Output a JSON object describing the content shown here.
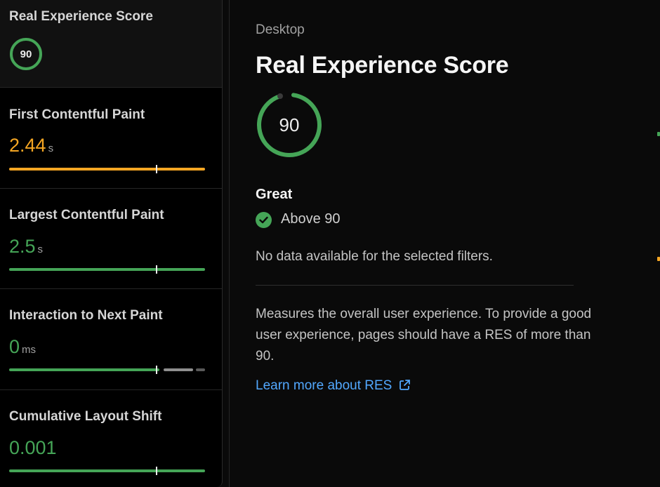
{
  "sidebar": {
    "cards": [
      {
        "title": "Real Experience Score",
        "score": "90",
        "selected": true
      },
      {
        "title": "First Contentful Paint",
        "value": "2.44",
        "unit": "s",
        "color": "#f5a623"
      },
      {
        "title": "Largest Contentful Paint",
        "value": "2.5",
        "unit": "s",
        "color": "#45a557"
      },
      {
        "title": "Interaction to Next Paint",
        "value": "0",
        "unit": "ms",
        "color": "#45a557"
      },
      {
        "title": "Cumulative Layout Shift",
        "value": "0.001",
        "unit": "",
        "color": "#45a557"
      }
    ]
  },
  "main": {
    "device": "Desktop",
    "title": "Real Experience Score",
    "score": "90",
    "status": "Great",
    "threshold": "Above 90",
    "no_data": "No data available for the selected filters.",
    "description": "Measures the overall user experience. To provide a good user experience, pages should have a RES of more than 90.",
    "learn_more": "Learn more about RES"
  },
  "colors": {
    "good": "#45a557",
    "warn": "#f5a623",
    "link": "#52a8ff",
    "muted": "#a1a1a1"
  }
}
